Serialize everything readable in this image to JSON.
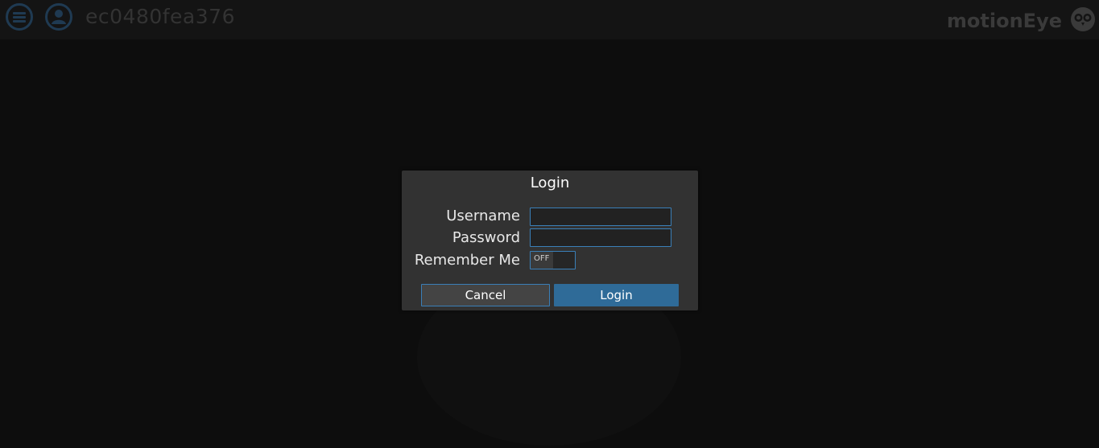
{
  "header": {
    "hostname": "ec0480fea376",
    "brand": "motionEye",
    "menu_icon": "menu-icon",
    "user_icon": "user-icon",
    "logo_icon": "owl-logo-icon"
  },
  "login_dialog": {
    "title": "Login",
    "username_label": "Username",
    "username_value": "",
    "password_label": "Password",
    "password_value": "",
    "remember_label": "Remember Me",
    "remember_state": "OFF",
    "cancel_label": "Cancel",
    "login_label": "Login"
  },
  "colors": {
    "accent": "#3a7fb8",
    "primary_button": "#2f6b98",
    "dialog_bg": "#323232",
    "page_bg": "#0d0d0d"
  }
}
